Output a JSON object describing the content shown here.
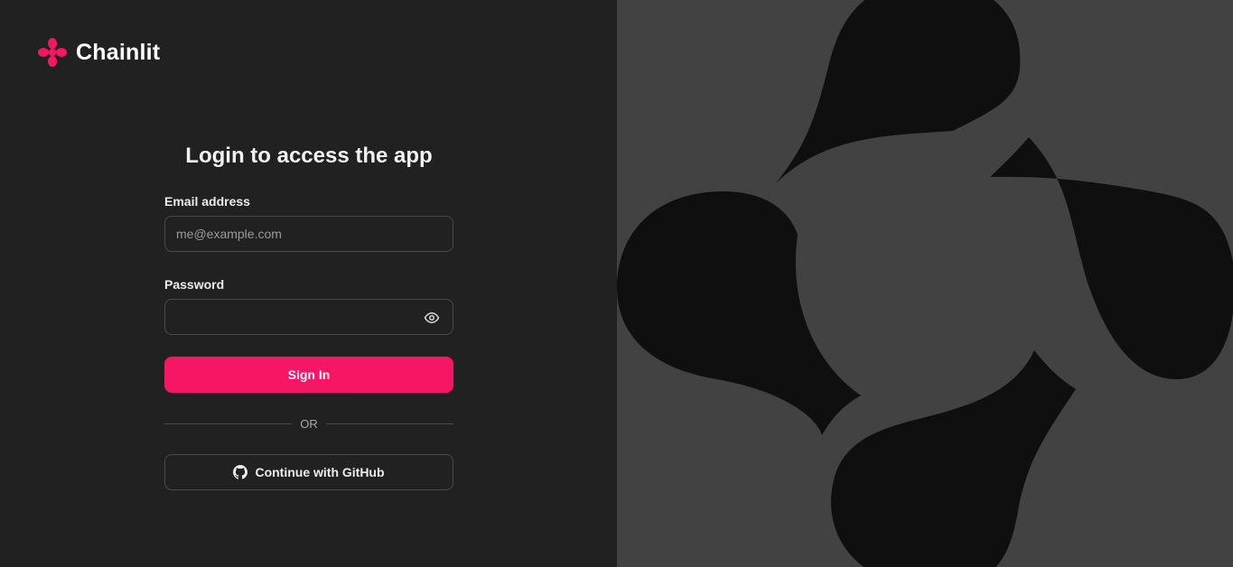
{
  "brand": {
    "name": "Chainlit",
    "logo_icon": "chainlit-logo-icon",
    "accent_color": "#f71566"
  },
  "login": {
    "title": "Login to access the app",
    "email_label": "Email address",
    "email_placeholder": "me@example.com",
    "email_value": "",
    "password_label": "Password",
    "password_value": "",
    "password_toggle_icon": "eye-icon",
    "sign_in_label": "Sign In",
    "divider_text": "OR",
    "github_label": "Continue with GitHub",
    "github_icon": "github-icon"
  },
  "colors": {
    "left_panel": "#212121",
    "right_panel": "#424242",
    "art_shape": "#0f0f0f"
  }
}
